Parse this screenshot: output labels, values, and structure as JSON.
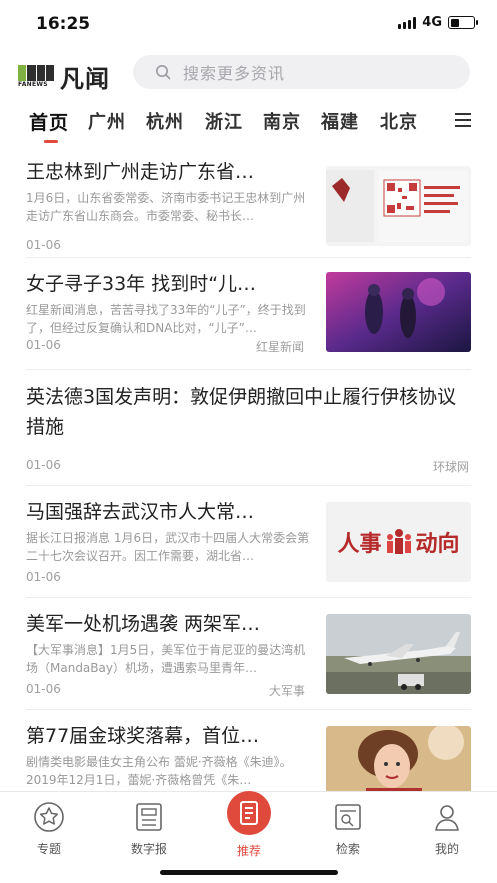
{
  "status_bar": {
    "time": "16:25",
    "network": "4G"
  },
  "header": {
    "logo_tag": "FANEWS",
    "logo_name": "凡闻",
    "search_placeholder": "搜索更多资讯"
  },
  "tabs": [
    "首页",
    "广州",
    "杭州",
    "浙江",
    "南京",
    "福建",
    "北京"
  ],
  "active_tab": "首页",
  "feed": [
    {
      "title": "王忠林到广州走访广东省…",
      "summary": "1月6日，山东省委常委、济南市委书记王忠林到广州走访广东省山东商会。市委常委、秘书长…",
      "date": "01-06",
      "source": ""
    },
    {
      "title": "女子寻子33年 找到时“儿…",
      "summary": "红星新闻消息，苦苦寻找了33年的“儿子”，终于找到了，但经过反复确认和DNA比对，“儿子”…",
      "date": "01-06",
      "source": "红星新闻"
    },
    {
      "title": "英法德3国发声明：敦促伊朗撤回中止履行伊核协议措施",
      "summary": "",
      "date": "01-06",
      "source": "环球网"
    },
    {
      "title": "马国强辞去武汉市人大常…",
      "summary": "据长江日报消息 1月6日，武汉市十四届人大常委会第二十七次会议召开。因工作需要，湖北省…",
      "date": "01-06",
      "source": "",
      "thumb_text_left": "人事",
      "thumb_text_right": "动向"
    },
    {
      "title": "美军一处机场遇袭 两架军…",
      "summary": "【大军事消息】1月5日，美军位于肯尼亚的曼达湾机场（MandaBay）机场，遭遇索马里青年…",
      "date": "01-06",
      "source": "大军事"
    },
    {
      "title": "第77届金球奖落幕，首位…",
      "summary": "剧情类电影最佳女主角公布 蕾妮·齐薇格《朱迪》。2019年12月1日，蕾妮·齐薇格曾凭《朱…",
      "date": "",
      "source": ""
    }
  ],
  "bottom_nav": [
    {
      "label": "专题",
      "icon": "star-badge-icon"
    },
    {
      "label": "数字报",
      "icon": "newspaper-icon"
    },
    {
      "label": "推荐",
      "icon": "recommend-icon"
    },
    {
      "label": "检索",
      "icon": "search-doc-icon"
    },
    {
      "label": "我的",
      "icon": "user-icon"
    }
  ],
  "colors": {
    "accent": "#e04a3c",
    "text": "#222222",
    "muted": "#a0a0a0"
  }
}
